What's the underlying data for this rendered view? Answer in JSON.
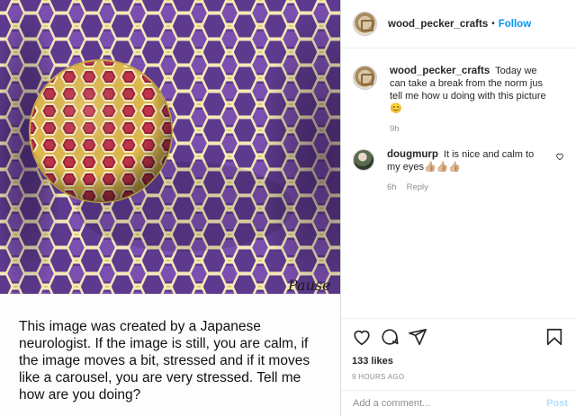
{
  "post": {
    "caption_overlay": "This image was created by a Japanese neurologist. If the image is still, you are calm, if the image moves a bit, stressed and if it moves like a carousel, you are very stressed. Tell me how are you doing?",
    "watermark": "Pause"
  },
  "header": {
    "username": "wood_pecker_crafts",
    "separator": "•",
    "follow_label": "Follow"
  },
  "comments": [
    {
      "username": "wood_pecker_crafts",
      "text": "Today we can take a break from the norm jus tell me how u doing with this picture 😊",
      "time": "9h"
    },
    {
      "username": "dougmurp",
      "text": "It is nice and calm to my eyes👍🏼👍🏼👍🏼",
      "time": "6h",
      "reply_label": "Reply"
    }
  ],
  "actions": {
    "icons": [
      "heart-icon",
      "comment-icon",
      "share-icon",
      "bookmark-icon"
    ],
    "likes": "133 likes",
    "time_ago": "9 HOURS AGO"
  },
  "add_comment": {
    "placeholder": "Add a comment...",
    "post_label": "Post"
  },
  "colors": {
    "link_blue": "#0095f6",
    "post_disabled": "#b2dffc",
    "muted": "#8e8e8e",
    "illusion_gold": "#c9a24a",
    "illusion_purple": "#6a3fa0",
    "illusion_red": "#a8283a"
  }
}
